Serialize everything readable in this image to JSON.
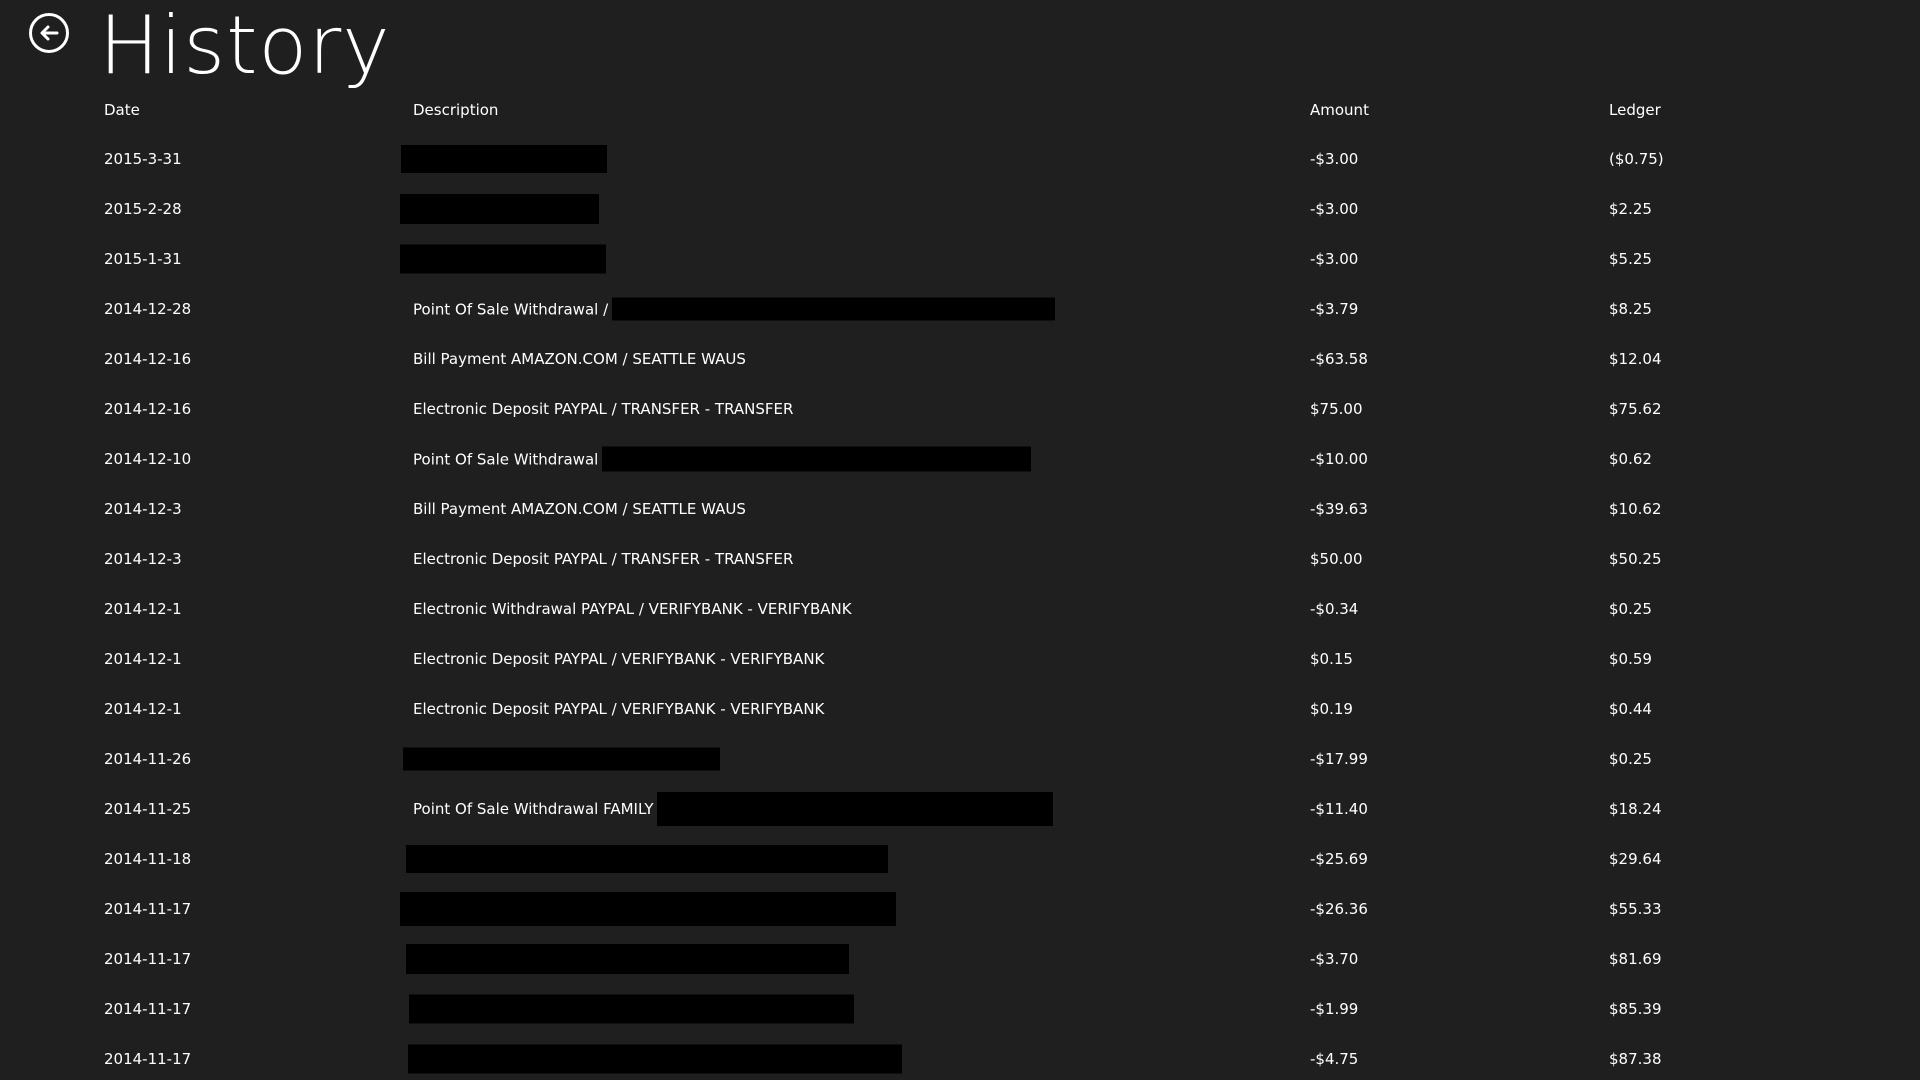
{
  "header": {
    "title": "History",
    "back_icon": "back-arrow-circle-icon"
  },
  "columns": {
    "date": "Date",
    "description": "Description",
    "amount": "Amount",
    "ledger": "Ledger"
  },
  "rows": [
    {
      "date": "2015-3-31",
      "description": "",
      "redacted": true,
      "amount": "-$3.00",
      "ledger": "($0.75)"
    },
    {
      "date": "2015-2-28",
      "description": "",
      "redacted": true,
      "amount": "-$3.00",
      "ledger": "$2.25"
    },
    {
      "date": "2015-1-31",
      "description": "",
      "redacted": true,
      "amount": "-$3.00",
      "ledger": "$5.25"
    },
    {
      "date": "2014-12-28",
      "description": "Point Of Sale Withdrawal /",
      "redacted": true,
      "amount": "-$3.79",
      "ledger": "$8.25"
    },
    {
      "date": "2014-12-16",
      "description": "Bill Payment AMAZON.COM / SEATTLE WAUS",
      "redacted": false,
      "amount": "-$63.58",
      "ledger": "$12.04"
    },
    {
      "date": "2014-12-16",
      "description": "Electronic Deposit PAYPAL / TRANSFER - TRANSFER",
      "redacted": false,
      "amount": "$75.00",
      "ledger": "$75.62"
    },
    {
      "date": "2014-12-10",
      "description": "Point Of Sale Withdrawal",
      "redacted": true,
      "amount": "-$10.00",
      "ledger": "$0.62"
    },
    {
      "date": "2014-12-3",
      "description": "Bill Payment AMAZON.COM / SEATTLE WAUS",
      "redacted": false,
      "amount": "-$39.63",
      "ledger": "$10.62"
    },
    {
      "date": "2014-12-3",
      "description": "Electronic Deposit PAYPAL / TRANSFER - TRANSFER",
      "redacted": false,
      "amount": "$50.00",
      "ledger": "$50.25"
    },
    {
      "date": "2014-12-1",
      "description": "Electronic Withdrawal PAYPAL / VERIFYBANK - VERIFYBANK",
      "redacted": false,
      "amount": "-$0.34",
      "ledger": "$0.25"
    },
    {
      "date": "2014-12-1",
      "description": "Electronic Deposit PAYPAL / VERIFYBANK - VERIFYBANK",
      "redacted": false,
      "amount": "$0.15",
      "ledger": "$0.59"
    },
    {
      "date": "2014-12-1",
      "description": "Electronic Deposit PAYPAL / VERIFYBANK - VERIFYBANK",
      "redacted": false,
      "amount": "$0.19",
      "ledger": "$0.44"
    },
    {
      "date": "2014-11-26",
      "description": "",
      "redacted": true,
      "amount": "-$17.99",
      "ledger": "$0.25"
    },
    {
      "date": "2014-11-25",
      "description": "Point Of Sale Withdrawal FAMILY",
      "redacted": true,
      "amount": "-$11.40",
      "ledger": "$18.24"
    },
    {
      "date": "2014-11-18",
      "description": "",
      "redacted": true,
      "amount": "-$25.69",
      "ledger": "$29.64"
    },
    {
      "date": "2014-11-17",
      "description": "",
      "redacted": true,
      "amount": "-$26.36",
      "ledger": "$55.33"
    },
    {
      "date": "2014-11-17",
      "description": "",
      "redacted": true,
      "amount": "-$3.70",
      "ledger": "$81.69"
    },
    {
      "date": "2014-11-17",
      "description": "",
      "redacted": true,
      "amount": "-$1.99",
      "ledger": "$85.39"
    },
    {
      "date": "2014-11-17",
      "description": "",
      "redacted": true,
      "amount": "-$4.75",
      "ledger": "$87.38"
    }
  ]
}
